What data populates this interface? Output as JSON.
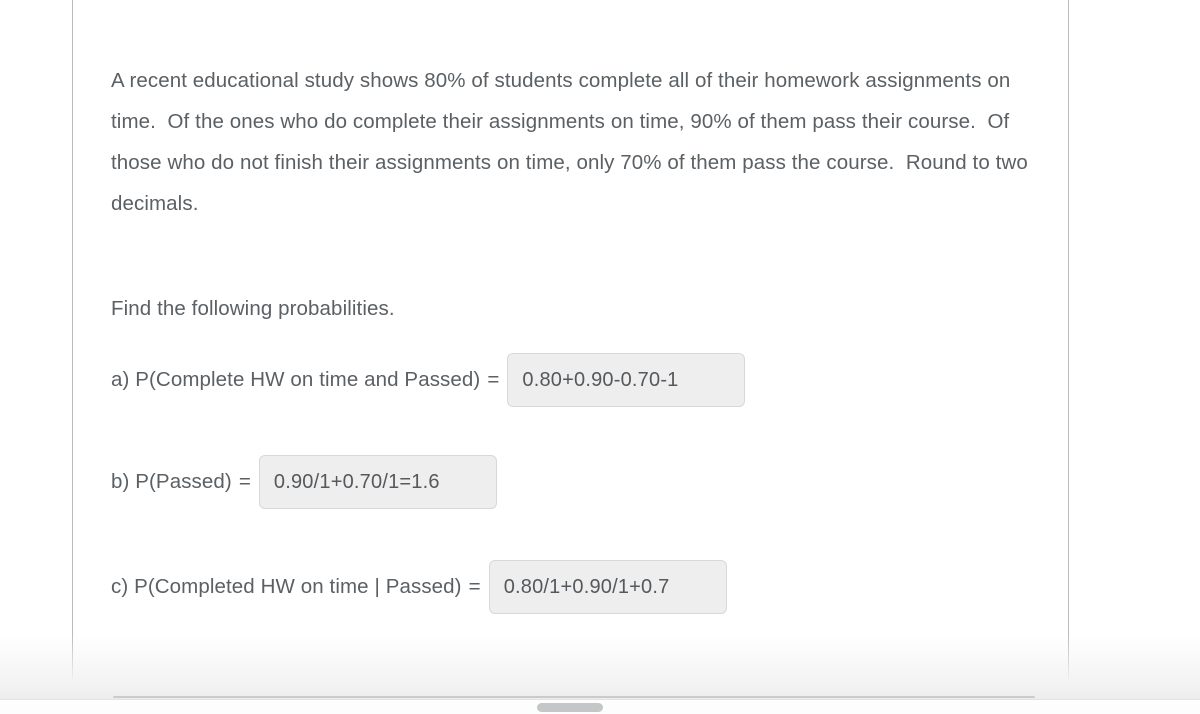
{
  "document": {
    "intro_paragraph": "A recent educational study shows 80% of students complete all of their homework assignments on time.  Of the ones who do complete their assignments on time, 90% of them pass their course.  Of those who do not finish their assignments on time, only 70% of them pass the course.  Round to two decimals.",
    "instruction_line": "Find the following probabilities."
  },
  "questions": [
    {
      "label": "a) P(Complete HW on time and Passed)",
      "equals": "=",
      "answer": "0.80+0.90-0.70-1",
      "placeholder": ""
    },
    {
      "label": "b) P(Passed)",
      "equals": "=",
      "answer": "0.90/1+0.70/1=1.6",
      "placeholder": ""
    },
    {
      "label": "c) P(Completed HW on time | Passed)",
      "equals": "=",
      "answer": "0.80/1+0.90/1+0.7",
      "placeholder": ""
    }
  ],
  "colors": {
    "text": "#5b6064",
    "answer_text": "#55595d",
    "answer_fill": "#eeeeee",
    "answer_border": "#d6d8da",
    "rail": "#b9bcbe",
    "scrollbar_thumb": "#c3c7c8",
    "page_background": "#ffffff"
  }
}
